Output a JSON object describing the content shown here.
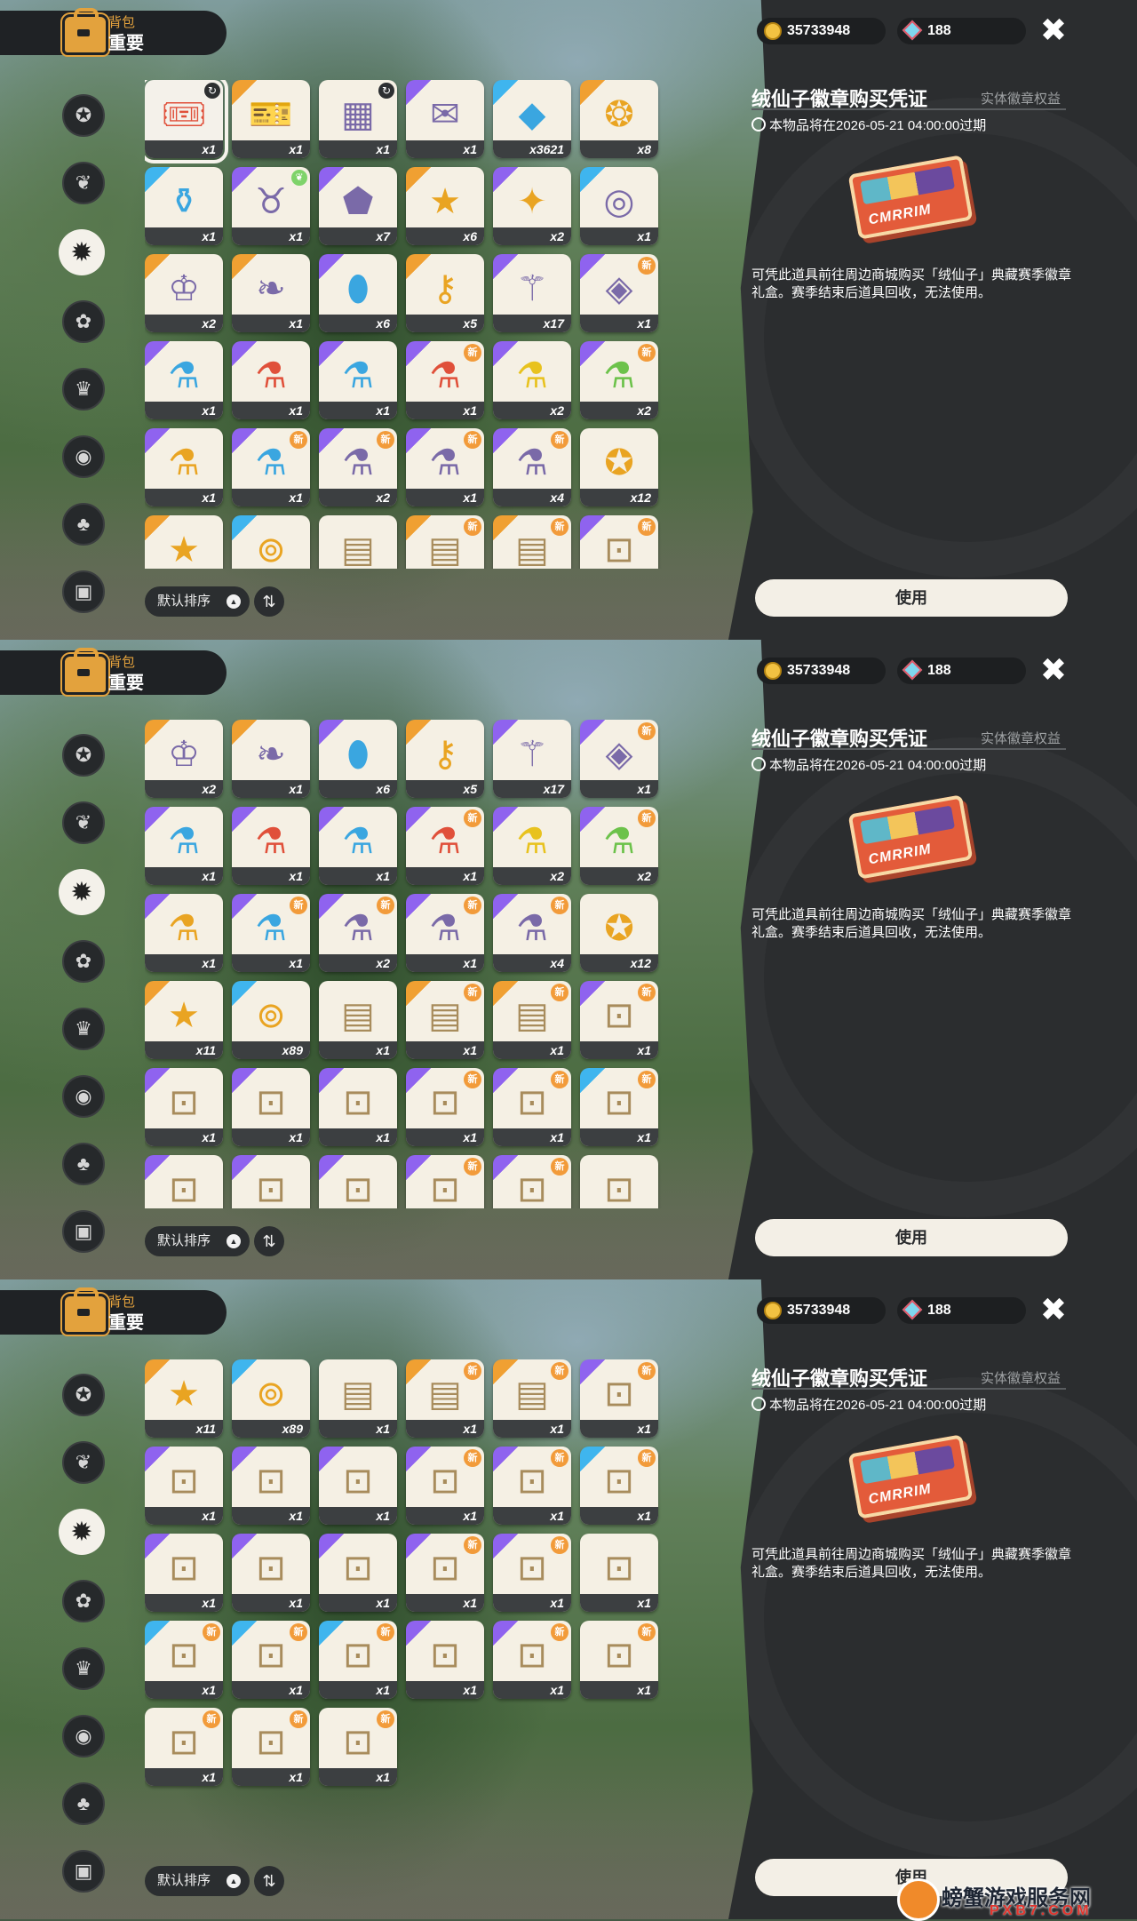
{
  "header": {
    "bag_label": "背包",
    "bag_tab": "重要"
  },
  "sidebar": {
    "categories": [
      {
        "icon": "badge-icon",
        "glyph": "✪"
      },
      {
        "icon": "leaf-icon",
        "glyph": "❦"
      },
      {
        "icon": "starburst-icon",
        "glyph": "✹",
        "active": true
      },
      {
        "icon": "sprout-icon",
        "glyph": "✿"
      },
      {
        "icon": "crown-card-icon",
        "glyph": "♛"
      },
      {
        "icon": "ball-icon",
        "glyph": "◉"
      },
      {
        "icon": "acorn-icon",
        "glyph": "♣"
      },
      {
        "icon": "chest-icon",
        "glyph": "▣"
      }
    ]
  },
  "sort": {
    "label": "默认排序",
    "arrow": "▲",
    "toggle": "⇅"
  },
  "currency": {
    "coins": "35733948",
    "gems": "188"
  },
  "close": "✖",
  "detail": {
    "title": "绒仙子徽章购买凭证",
    "tag": "实体徽章权益",
    "expire": "本物品将在2026-05-21 04:00:00过期",
    "ticket_text": "CMRRIM",
    "description": "可凭此道具前往周边商城购买「绒仙子」典藏赛季徽章礼盒。赛季结束后道具回收，无法使用。",
    "use_button": "使用"
  },
  "watermark": {
    "name": "螃蟹游戏服务网",
    "url": "PXB7.COM"
  },
  "inventory": [
    {
      "icon": "ticket-icon",
      "glyph": "🎟",
      "count": "x1",
      "rarity": "gold",
      "selected": true,
      "badge": "cycle"
    },
    {
      "icon": "card-pack-icon",
      "glyph": "🎫",
      "count": "x1",
      "rarity": "gold"
    },
    {
      "icon": "chip-card-icon",
      "glyph": "▦",
      "count": "x1",
      "rarity": "",
      "badge": "cycle"
    },
    {
      "icon": "postcard-icon",
      "glyph": "✉",
      "count": "x1",
      "rarity": "purple"
    },
    {
      "icon": "crystal-icon",
      "glyph": "◆",
      "count": "x3621",
      "rarity": "blue"
    },
    {
      "icon": "bell-coin-icon",
      "glyph": "❂",
      "count": "x8",
      "rarity": "gold"
    },
    {
      "icon": "blue-potion-icon",
      "glyph": "⚱",
      "count": "x1",
      "rarity": "blue"
    },
    {
      "icon": "pouch-icon",
      "glyph": "♉",
      "count": "x1",
      "rarity": "purple",
      "badge": "leaf"
    },
    {
      "icon": "gem-shard-icon",
      "glyph": "⬟",
      "count": "x7",
      "rarity": "purple"
    },
    {
      "icon": "gold-star-icon",
      "glyph": "★",
      "count": "x6",
      "rarity": "gold"
    },
    {
      "icon": "purple-star-icon",
      "glyph": "✦",
      "count": "x2",
      "rarity": "purple"
    },
    {
      "icon": "ring-icon",
      "glyph": "◎",
      "count": "x1",
      "rarity": "blue"
    },
    {
      "icon": "tiara-icon",
      "glyph": "♔",
      "count": "x2",
      "rarity": "gold"
    },
    {
      "icon": "leaf-badge-icon",
      "glyph": "❧",
      "count": "x1",
      "rarity": "gold"
    },
    {
      "icon": "blue-stone-icon",
      "glyph": "⬮",
      "count": "x6",
      "rarity": "purple"
    },
    {
      "icon": "key-icon",
      "glyph": "⚷",
      "count": "x5",
      "rarity": "gold"
    },
    {
      "icon": "wand-icon",
      "glyph": "⚚",
      "count": "x17",
      "rarity": "purple"
    },
    {
      "icon": "prism-icon",
      "glyph": "◈",
      "count": "x1",
      "rarity": "purple",
      "badge": "new"
    },
    {
      "icon": "blue-bottle-icon",
      "glyph": "⚗",
      "count": "x1",
      "rarity": "purple"
    },
    {
      "icon": "red-bottle-icon",
      "glyph": "⚗",
      "count": "x1",
      "rarity": "purple"
    },
    {
      "icon": "sky-bottle-icon",
      "glyph": "⚗",
      "count": "x1",
      "rarity": "purple"
    },
    {
      "icon": "heart-bottle-icon",
      "glyph": "⚗",
      "count": "x1",
      "rarity": "purple",
      "badge": "new"
    },
    {
      "icon": "yellow-bottle-icon",
      "glyph": "⚗",
      "count": "x2",
      "rarity": "purple"
    },
    {
      "icon": "green-bottle-icon",
      "glyph": "⚗",
      "count": "x2",
      "rarity": "purple",
      "badge": "new"
    },
    {
      "icon": "amber-bottle-icon",
      "glyph": "⚗",
      "count": "x1",
      "rarity": "purple"
    },
    {
      "icon": "teal-bottle-icon",
      "glyph": "⚗",
      "count": "x1",
      "rarity": "purple",
      "badge": "new"
    },
    {
      "icon": "violet-bottle-icon",
      "glyph": "⚗",
      "count": "x2",
      "rarity": "purple",
      "badge": "new"
    },
    {
      "icon": "flower-bottle-icon",
      "glyph": "⚗",
      "count": "x1",
      "rarity": "purple",
      "badge": "new"
    },
    {
      "icon": "swirl-bottle-icon",
      "glyph": "⚗",
      "count": "x4",
      "rarity": "purple",
      "badge": "new"
    },
    {
      "icon": "teal-star-icon",
      "glyph": "✪",
      "count": "x12",
      "rarity": ""
    },
    {
      "icon": "star-medal-icon",
      "glyph": "★",
      "count": "x11",
      "rarity": "gold"
    },
    {
      "icon": "silver-coin-icon",
      "glyph": "⊚",
      "count": "x89",
      "rarity": "blue"
    },
    {
      "icon": "map-scroll-icon",
      "glyph": "▤",
      "count": "x1",
      "rarity": ""
    },
    {
      "icon": "map-scroll-icon",
      "glyph": "▤",
      "count": "x1",
      "rarity": "gold",
      "badge": "new"
    },
    {
      "icon": "map-scroll-icon",
      "glyph": "▤",
      "count": "x1",
      "rarity": "gold",
      "badge": "new"
    },
    {
      "icon": "blue-scroll-icon",
      "glyph": "⊡",
      "count": "x1",
      "rarity": "purple",
      "badge": "new"
    },
    {
      "icon": "blue-scroll-icon",
      "glyph": "⊡",
      "count": "x1",
      "rarity": "purple"
    },
    {
      "icon": "blue-scroll-icon",
      "glyph": "⊡",
      "count": "x1",
      "rarity": "purple"
    },
    {
      "icon": "blue-scroll-icon",
      "glyph": "⊡",
      "count": "x1",
      "rarity": "purple"
    },
    {
      "icon": "green-scroll-icon",
      "glyph": "⊡",
      "count": "x1",
      "rarity": "purple",
      "badge": "new"
    },
    {
      "icon": "green-scroll-icon",
      "glyph": "⊡",
      "count": "x1",
      "rarity": "purple",
      "badge": "new"
    },
    {
      "icon": "red-scroll-icon",
      "glyph": "⊡",
      "count": "x1",
      "rarity": "blue",
      "badge": "new"
    },
    {
      "icon": "red-scroll-icon",
      "glyph": "⊡",
      "count": "x1",
      "rarity": "purple"
    },
    {
      "icon": "red-scroll-icon",
      "glyph": "⊡",
      "count": "x1",
      "rarity": "purple"
    },
    {
      "icon": "teal-scroll-icon",
      "glyph": "⊡",
      "count": "x1",
      "rarity": "purple"
    },
    {
      "icon": "teal-scroll-icon",
      "glyph": "⊡",
      "count": "x1",
      "rarity": "purple",
      "badge": "new"
    },
    {
      "icon": "teal-scroll-icon",
      "glyph": "⊡",
      "count": "x1",
      "rarity": "purple",
      "badge": "new"
    },
    {
      "icon": "gold-scroll-icon",
      "glyph": "⊡",
      "count": "x1",
      "rarity": ""
    },
    {
      "icon": "gold-scroll-icon",
      "glyph": "⊡",
      "count": "x1",
      "rarity": "blue",
      "badge": "new"
    },
    {
      "icon": "gold-scroll-icon",
      "glyph": "⊡",
      "count": "x1",
      "rarity": "blue",
      "badge": "new"
    },
    {
      "icon": "gold-scroll-icon",
      "glyph": "⊡",
      "count": "x1",
      "rarity": "blue",
      "badge": "new"
    },
    {
      "icon": "cyan-scroll-icon",
      "glyph": "⊡",
      "count": "x1",
      "rarity": "purple"
    },
    {
      "icon": "cyan-scroll-icon",
      "glyph": "⊡",
      "count": "x1",
      "rarity": "purple",
      "badge": "new"
    },
    {
      "icon": "cyan-scroll-icon",
      "glyph": "⊡",
      "count": "x1",
      "rarity": "",
      "badge": "new"
    },
    {
      "icon": "rainbow-scroll-icon",
      "glyph": "⊡",
      "count": "x1",
      "rarity": "",
      "badge": "new"
    },
    {
      "icon": "rainbow-scroll-icon",
      "glyph": "⊡",
      "count": "x1",
      "rarity": "",
      "badge": "new"
    },
    {
      "icon": "rainbow-scroll-icon",
      "glyph": "⊡",
      "count": "x1",
      "rarity": "",
      "badge": "new"
    }
  ]
}
